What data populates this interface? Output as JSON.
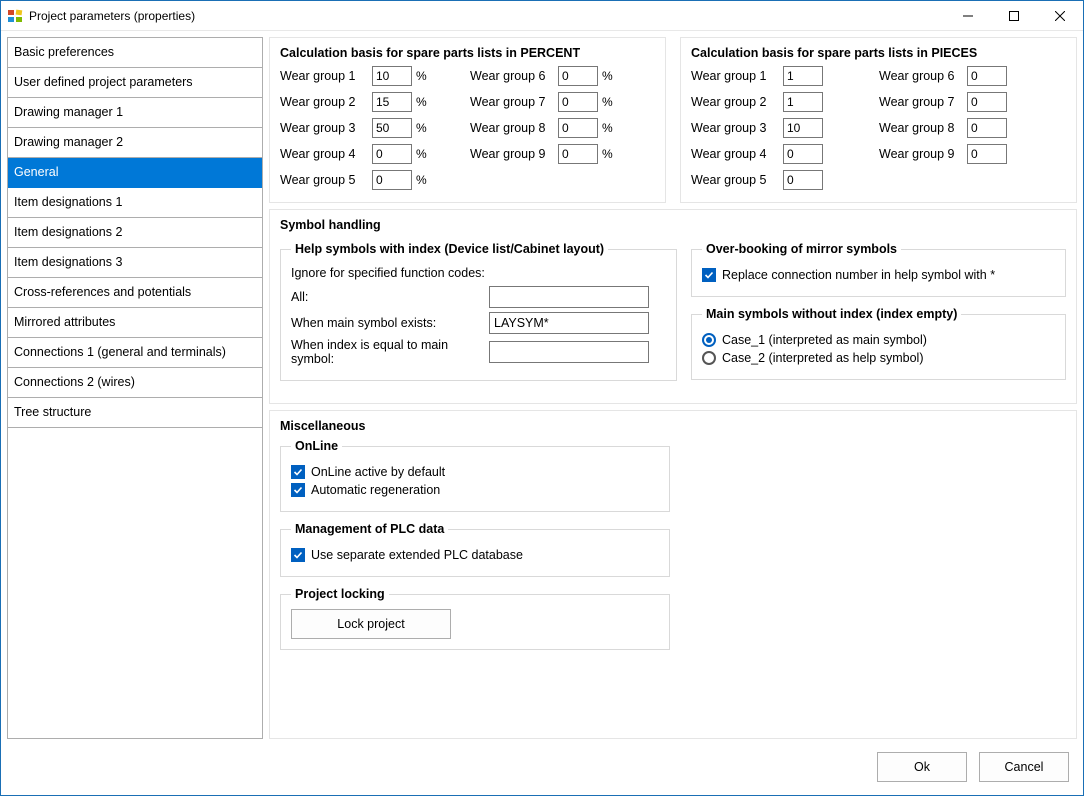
{
  "window": {
    "title": "Project parameters (properties)"
  },
  "sidebar": {
    "items": [
      "Basic preferences",
      "User defined project parameters",
      "Drawing manager 1",
      "Drawing manager 2",
      "General",
      "Item designations 1",
      "Item designations 2",
      "Item designations 3",
      "Cross-references and potentials",
      "Mirrored attributes",
      "Connections 1 (general and terminals)",
      "Connections 2 (wires)",
      "Tree structure"
    ],
    "active_index": 4
  },
  "calc_percent": {
    "title": "Calculation basis for spare parts lists in PERCENT",
    "labels": [
      "Wear group 1",
      "Wear group 2",
      "Wear group 3",
      "Wear group 4",
      "Wear group 5",
      "Wear group 6",
      "Wear group 7",
      "Wear group 8",
      "Wear group 9"
    ],
    "values": [
      "10",
      "15",
      "50",
      "0",
      "0",
      "0",
      "0",
      "0",
      "0"
    ],
    "unit": "%"
  },
  "calc_pieces": {
    "title": "Calculation basis for spare parts lists in PIECES",
    "labels": [
      "Wear group 1",
      "Wear group 2",
      "Wear group 3",
      "Wear group 4",
      "Wear group 5",
      "Wear group 6",
      "Wear group 7",
      "Wear group 8",
      "Wear group 9"
    ],
    "values": [
      "1",
      "1",
      "10",
      "0",
      "0",
      "0",
      "0",
      "0",
      "0"
    ]
  },
  "symbol_handling": {
    "title": "Symbol handling",
    "help_symbols": {
      "title": "Help symbols with index (Device list/Cabinet layout)",
      "ignore_label": "Ignore for specified function codes:",
      "all_label": "All:",
      "all_value": "",
      "main_exists_label": "When main symbol exists:",
      "main_exists_value": "LAYSYM*",
      "index_equal_label": "When index is equal to main symbol:",
      "index_equal_value": ""
    },
    "overbooking": {
      "title": "Over-booking of mirror symbols",
      "replace_label": "Replace connection number in help symbol with *",
      "replace_checked": true
    },
    "main_no_index": {
      "title": "Main symbols without index (index empty)",
      "option1": "Case_1 (interpreted as main symbol)",
      "option2": "Case_2 (interpreted as help symbol)",
      "selected": 1
    }
  },
  "misc": {
    "title": "Miscellaneous",
    "online": {
      "title": "OnLine",
      "active_label": "OnLine active by default",
      "active_checked": true,
      "regen_label": "Automatic regeneration",
      "regen_checked": true
    },
    "plc": {
      "title": "Management of PLC data",
      "use_sep_label": "Use separate extended PLC database",
      "use_sep_checked": true
    },
    "locking": {
      "title": "Project locking",
      "button": "Lock project"
    }
  },
  "footer": {
    "ok": "Ok",
    "cancel": "Cancel"
  }
}
